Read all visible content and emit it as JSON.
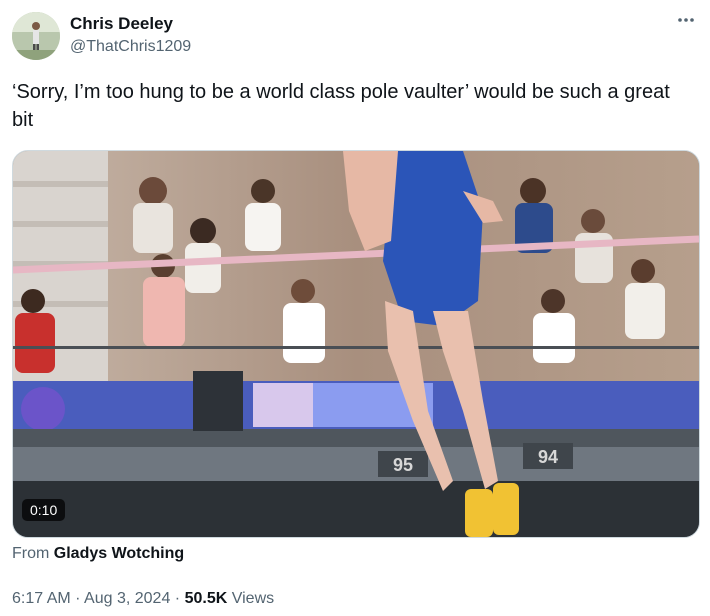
{
  "author": {
    "name": "Chris Deeley",
    "handle": "@ThatChris1209"
  },
  "tweet": {
    "text": "‘Sorry, I’m too hung to be a world class pole vaulter’ would be such a great bit"
  },
  "media": {
    "duration": "0:10",
    "seat_labels": [
      "95",
      "94"
    ],
    "source_prefix": "From",
    "source_name": "Gladys Wotching"
  },
  "meta": {
    "time": "6:17 AM",
    "date": "Aug 3, 2024",
    "views_count": "50.5K",
    "views_label": "Views",
    "separator": "·"
  },
  "icons": {
    "more": "more-dots-icon"
  }
}
